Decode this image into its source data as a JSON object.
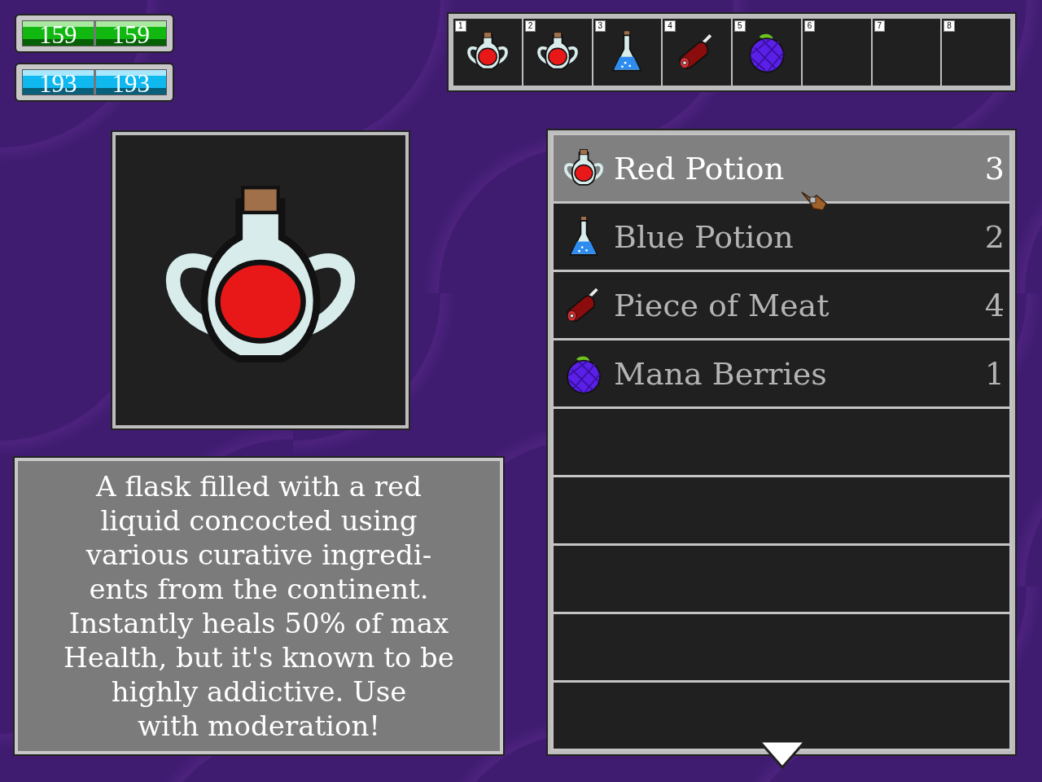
{
  "stat_bars": [
    {
      "kind": "health",
      "current": "159",
      "max": "159",
      "level": 1
    },
    {
      "kind": "mana",
      "current": "193",
      "max": "193",
      "level": 1
    }
  ],
  "hotbar": [
    {
      "number": "1",
      "kind": "red-potion"
    },
    {
      "number": "2",
      "kind": "red-potion"
    },
    {
      "number": "3",
      "kind": "blue-potion"
    },
    {
      "number": "4",
      "kind": "meat"
    },
    {
      "number": "5",
      "kind": "berry"
    },
    {
      "number": "6",
      "kind": "empty"
    },
    {
      "number": "7",
      "kind": "empty"
    },
    {
      "number": "8",
      "kind": "empty"
    }
  ],
  "preview": {
    "kind": "red-potion"
  },
  "description": {
    "lines": [
      "A flask filled with a red",
      "liquid concocted using",
      "various curative ingredi-",
      "ents from the continent.",
      "Instantly heals 50% of max",
      "Health, but it's known to be",
      "highly addictive. Use",
      "with moderation!"
    ]
  },
  "items": [
    {
      "kind": "red-potion",
      "name": "Red Potion",
      "count": "3",
      "selected": true
    },
    {
      "kind": "blue-potion",
      "name": "Blue Potion",
      "count": "2",
      "selected": false
    },
    {
      "kind": "meat",
      "name": "Piece of Meat",
      "count": "4",
      "selected": false
    },
    {
      "kind": "berry",
      "name": "Mana Berries",
      "count": "1",
      "selected": false
    }
  ],
  "more_below": true
}
